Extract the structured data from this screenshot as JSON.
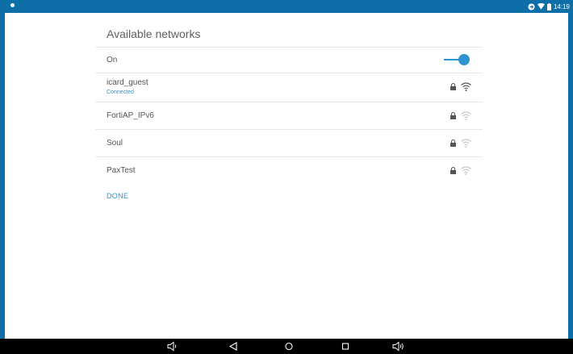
{
  "status_bar": {
    "time": "14:19",
    "icons": [
      "notification-dot-icon",
      "sync-icon",
      "wifi-icon",
      "battery-icon"
    ]
  },
  "panel": {
    "title": "Available networks",
    "toggle": {
      "label": "On",
      "state": "on"
    },
    "networks": [
      {
        "name": "icard_guest",
        "status": "Connected",
        "secured": true,
        "signal": "strong"
      },
      {
        "name": "FortiAP_IPv6",
        "status": "",
        "secured": true,
        "signal": "weak"
      },
      {
        "name": "Soul",
        "status": "",
        "secured": true,
        "signal": "weak"
      },
      {
        "name": "PaxTest",
        "status": "",
        "secured": true,
        "signal": "weak"
      }
    ],
    "done_label": "DONE"
  },
  "nav_bar": {
    "icons": [
      "volume-down-icon",
      "back-icon",
      "home-icon",
      "recents-icon",
      "volume-up-icon"
    ]
  },
  "colors": {
    "accent": "#2f93d0",
    "frame": "#0e6ea8",
    "nav_background": "#000000"
  }
}
